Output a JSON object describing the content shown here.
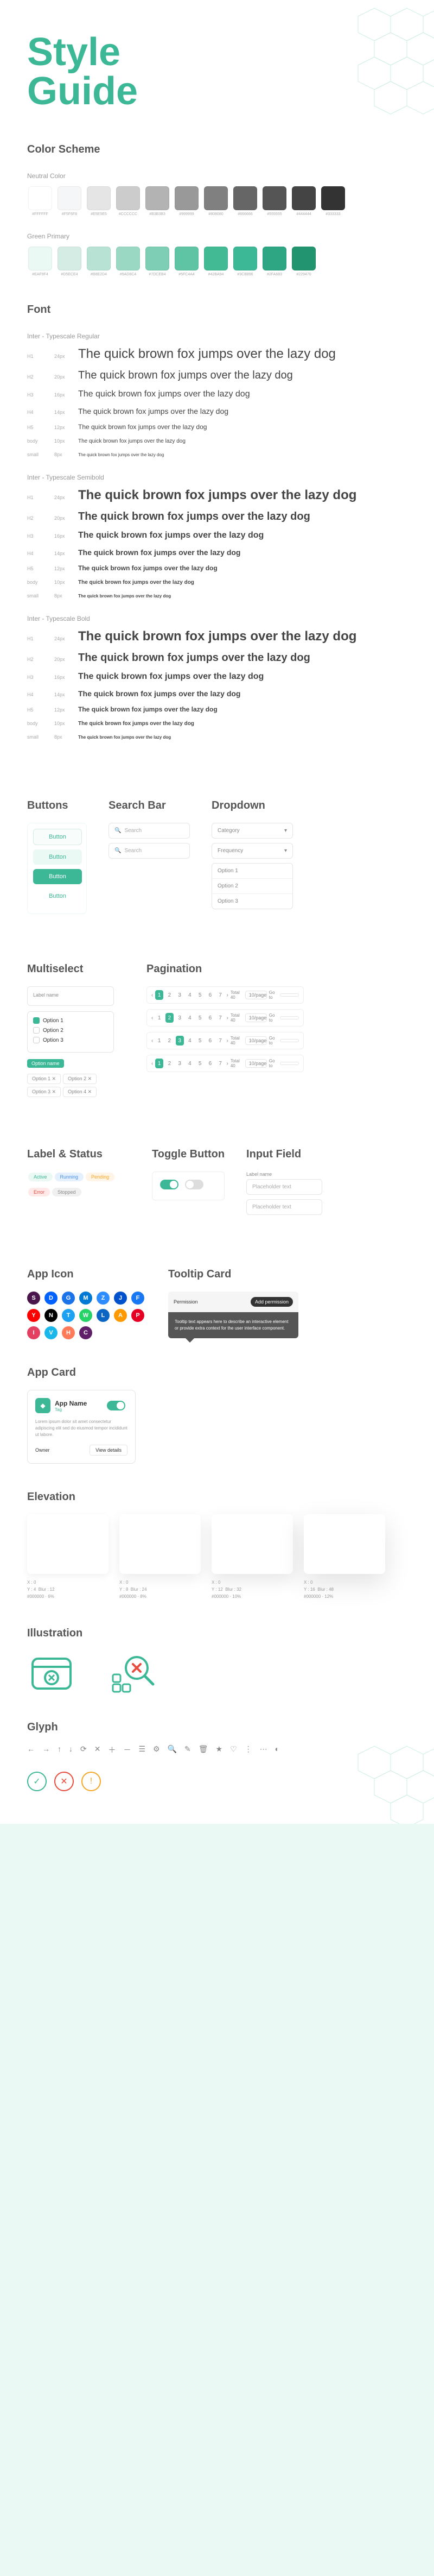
{
  "title_line1": "Style",
  "title_line2": "Guide",
  "sections": {
    "color_scheme": "Color Scheme",
    "neutral": "Neutral Color",
    "green": "Green Primary",
    "font": "Font",
    "type_regular": "Inter - Typescale Regular",
    "type_semibold": "Inter - Typescale Semibold",
    "type_bold": "Inter - Typescale Bold",
    "buttons": "Buttons",
    "search": "Search Bar",
    "dropdown": "Dropdown",
    "multiselect": "Multiselect",
    "pagination": "Pagination",
    "label_status": "Label & Status",
    "toggle": "Toggle Button",
    "input": "Input Field",
    "app_icon": "App Icon",
    "tooltip": "Tooltip Card",
    "app_card": "App Card",
    "elevation": "Elevation",
    "illustration": "Illustration",
    "glyph": "Glyph"
  },
  "neutral_swatches": [
    {
      "hex": "#FFFFFF",
      "label": "#FFFFFF"
    },
    {
      "hex": "#F5F6F8",
      "label": "#F5F6F8"
    },
    {
      "hex": "#E5E5E5",
      "label": "#E5E5E5"
    },
    {
      "hex": "#CCCCCC",
      "label": "#CCCCCC"
    },
    {
      "hex": "#B3B3B3",
      "label": "#B3B3B3"
    },
    {
      "hex": "#999999",
      "label": "#999999"
    },
    {
      "hex": "#808080",
      "label": "#808080"
    },
    {
      "hex": "#666666",
      "label": "#666666"
    },
    {
      "hex": "#555555",
      "label": "#555555"
    },
    {
      "hex": "#444444",
      "label": "#444444"
    },
    {
      "hex": "#333333",
      "label": "#333333"
    }
  ],
  "green_swatches": [
    {
      "hex": "#EAF9F4",
      "label": "#EAF9F4"
    },
    {
      "hex": "#D5ECE4",
      "label": "#D5ECE4"
    },
    {
      "hex": "#B8E2D4",
      "label": "#B8E2D4"
    },
    {
      "hex": "#9AD8C4",
      "label": "#9AD8C4"
    },
    {
      "hex": "#7DCEB4",
      "label": "#7DCEB4"
    },
    {
      "hex": "#5FC4A4",
      "label": "#5FC4A4"
    },
    {
      "hex": "#42BA94",
      "label": "#42BA94"
    },
    {
      "hex": "#3CB896",
      "label": "#3CB896"
    },
    {
      "hex": "#2FA683",
      "label": "#2FA683"
    },
    {
      "hex": "#229470",
      "label": "#229470"
    }
  ],
  "typescale": [
    {
      "label": "H1",
      "size": "24px",
      "px": 24,
      "sample": "The quick brown fox jumps over the lazy dog"
    },
    {
      "label": "H2",
      "size": "20px",
      "px": 20,
      "sample": "The quick brown fox jumps over the lazy dog"
    },
    {
      "label": "H3",
      "size": "16px",
      "px": 16,
      "sample": "The quick brown fox jumps over the lazy dog"
    },
    {
      "label": "H4",
      "size": "14px",
      "px": 14,
      "sample": "The quick brown fox jumps over the lazy dog"
    },
    {
      "label": "H5",
      "size": "12px",
      "px": 12,
      "sample": "The quick brown fox jumps over the lazy dog"
    },
    {
      "label": "body",
      "size": "10px",
      "px": 10,
      "sample": "The quick brown fox jumps over the lazy dog"
    },
    {
      "label": "small",
      "size": "8px",
      "px": 8,
      "sample": "The quick brown fox jumps over the lazy dog"
    }
  ],
  "buttons": {
    "primary": "Button",
    "ghost": "Button",
    "text": "Button",
    "light": "Button"
  },
  "search": {
    "placeholder1": "Search",
    "placeholder2": "Search"
  },
  "dropdown": {
    "category": "Category",
    "frequency": "Frequency",
    "options": [
      "Option 1",
      "Option 2",
      "Option 3"
    ]
  },
  "multiselect": {
    "label": "Label name",
    "options": [
      "Option 1",
      "Option 2",
      "Option 3"
    ],
    "selected_tag": "Option name",
    "tags": [
      "Option 1",
      "Option 2",
      "Option 3",
      "Option 4"
    ]
  },
  "pagination": {
    "pages": [
      "1",
      "2",
      "3",
      "4",
      "5",
      "6",
      "7"
    ],
    "total": "Total 40",
    "perpage": "10/page",
    "go": "Go to"
  },
  "labels": [
    {
      "text": "Active",
      "bg": "#eaf9f4",
      "color": "#3cb896"
    },
    {
      "text": "Running",
      "bg": "#e5f0ff",
      "color": "#4a90e2"
    },
    {
      "text": "Pending",
      "bg": "#fff4e5",
      "color": "#f5a623"
    },
    {
      "text": "Error",
      "bg": "#ffe9e9",
      "color": "#e74c3c"
    },
    {
      "text": "Stopped",
      "bg": "#f0f0f0",
      "color": "#888"
    }
  ],
  "input": {
    "label": "Label name",
    "placeholder": "Placeholder text"
  },
  "app_icons": [
    {
      "char": "S",
      "bg": "#4a154b"
    },
    {
      "char": "D",
      "bg": "#0061ff"
    },
    {
      "char": "G",
      "bg": "#1a73e8"
    },
    {
      "char": "M",
      "bg": "#0078d4"
    },
    {
      "char": "Z",
      "bg": "#2d8cff"
    },
    {
      "char": "J",
      "bg": "#0052cc"
    },
    {
      "char": "F",
      "bg": "#1877f2"
    },
    {
      "char": "Y",
      "bg": "#ff0000"
    },
    {
      "char": "N",
      "bg": "#000000"
    },
    {
      "char": "T",
      "bg": "#1da1f2"
    },
    {
      "char": "W",
      "bg": "#25d366"
    },
    {
      "char": "L",
      "bg": "#0a66c2"
    },
    {
      "char": "A",
      "bg": "#ff9900"
    },
    {
      "char": "P",
      "bg": "#e60023"
    },
    {
      "char": "I",
      "bg": "#e4405f"
    },
    {
      "char": "V",
      "bg": "#1ab7ea"
    },
    {
      "char": "H",
      "bg": "#ff7a59"
    },
    {
      "char": "C",
      "bg": "#611f69"
    }
  ],
  "tooltip": {
    "permission": "Permission",
    "btn": "Add permission",
    "body": "Tooltip text appears here to describe an interactive element or provide extra context for the user interface component."
  },
  "app_card": {
    "name": "App Name",
    "tag": "Tag",
    "body": "Lorem ipsum dolor sit amet consectetur adipiscing elit sed do eiusmod tempor incididunt ut labore.",
    "owner": "Owner",
    "details": "View details"
  },
  "elevation": [
    {
      "x": "X : 0",
      "y": "Y : 4",
      "blur": "Blur : 12",
      "color": "#000000 · 6%"
    },
    {
      "x": "X : 0",
      "y": "Y : 8",
      "blur": "Blur : 24",
      "color": "#000000 · 8%"
    },
    {
      "x": "X : 0",
      "y": "Y : 12",
      "blur": "Blur : 32",
      "color": "#000000 · 10%"
    },
    {
      "x": "X : 0",
      "y": "Y : 16",
      "blur": "Blur : 48",
      "color": "#000000 · 12%"
    }
  ],
  "glyphs": [
    "←",
    "→",
    "↑",
    "↓",
    "⟳",
    "✕",
    "＋",
    "－",
    "☰",
    "⚙",
    "🔍",
    "✎",
    "🗑",
    "★",
    "♡",
    "⋮",
    "⋯",
    "◐"
  ]
}
